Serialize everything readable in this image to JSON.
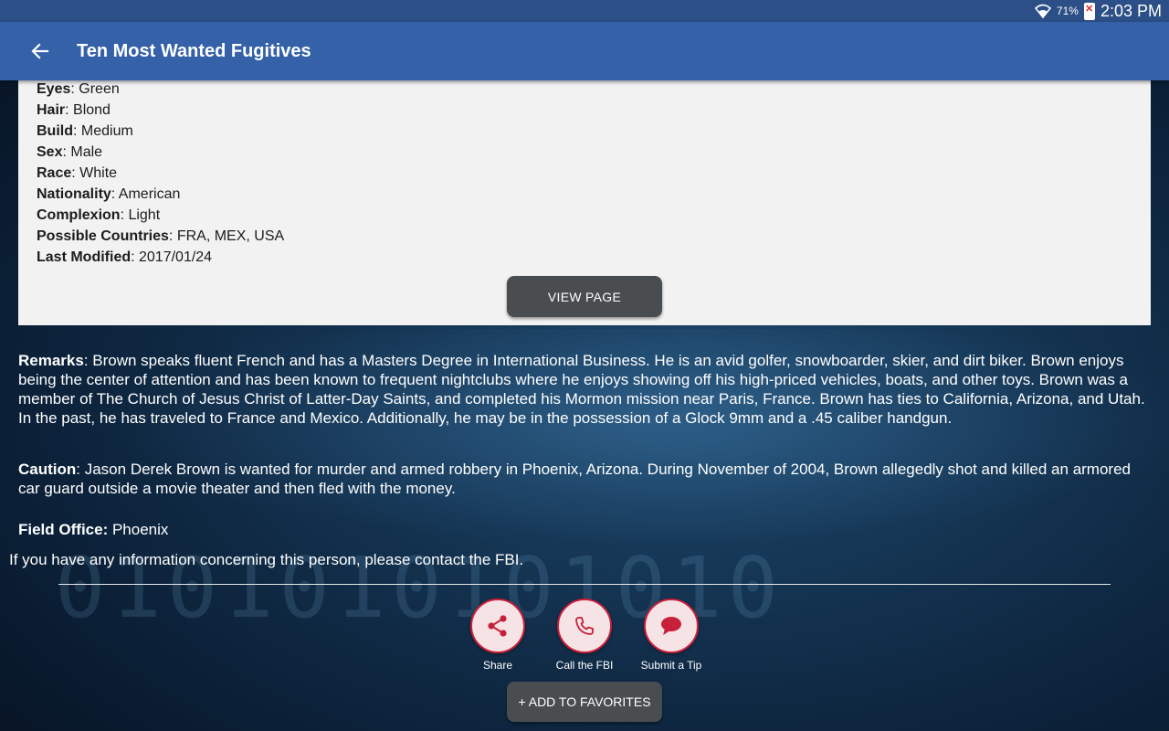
{
  "status_bar": {
    "battery_pct": "71%",
    "time": "2:03 PM"
  },
  "app_bar": {
    "title": "Ten Most Wanted Fugitives",
    "back_icon": "arrow-left-icon"
  },
  "details": [
    {
      "label": "Eyes",
      "value": ": Green"
    },
    {
      "label": "Hair",
      "value": ": Blond"
    },
    {
      "label": "Build",
      "value": ": Medium"
    },
    {
      "label": "Sex",
      "value": ": Male"
    },
    {
      "label": "Race",
      "value": ": White"
    },
    {
      "label": "Nationality",
      "value": ": American"
    },
    {
      "label": "Complexion",
      "value": ": Light"
    },
    {
      "label": "Possible Countries",
      "value": ": FRA, MEX, USA"
    },
    {
      "label": "Last Modified",
      "value": ": 2017/01/24"
    }
  ],
  "view_page_label": "VIEW PAGE",
  "remarks": {
    "label": "Remarks",
    "text": ": Brown speaks fluent French and has a Masters Degree in International Business. He is an avid golfer, snowboarder, skier, and dirt biker. Brown enjoys being the center of attention and has been known to frequent nightclubs where he enjoys showing off his high-priced vehicles, boats, and other toys. Brown was a member of The Church of Jesus Christ of Latter-Day Saints, and completed his Mormon mission near Paris, France.   Brown has ties to California, Arizona, and Utah. In the past, he has traveled to France and Mexico. Additionally, he may be in the possession of a Glock 9mm and a .45 caliber handgun."
  },
  "caution": {
    "label": "Caution",
    "text": ": Jason Derek Brown is wanted for murder and armed robbery in Phoenix, Arizona. During November of 2004, Brown allegedly shot and killed an armored car guard outside a movie theater and then fled with the money."
  },
  "field_office": {
    "label": "Field Office:",
    "value": " Phoenix"
  },
  "contact_text": "If you have any information concerning this person, please contact the FBI.",
  "actions": [
    {
      "label": "Share",
      "icon": "share-icon"
    },
    {
      "label": "Call the FBI",
      "icon": "phone-icon"
    },
    {
      "label": "Submit a Tip",
      "icon": "chat-bubble-icon"
    }
  ],
  "favorites_label": "+ ADD TO FAVORITES",
  "colors": {
    "app_bar": "#3461a8",
    "status_bar": "#2b4f86",
    "accent_red": "#c8203a",
    "button_gray": "#4a4d50"
  }
}
